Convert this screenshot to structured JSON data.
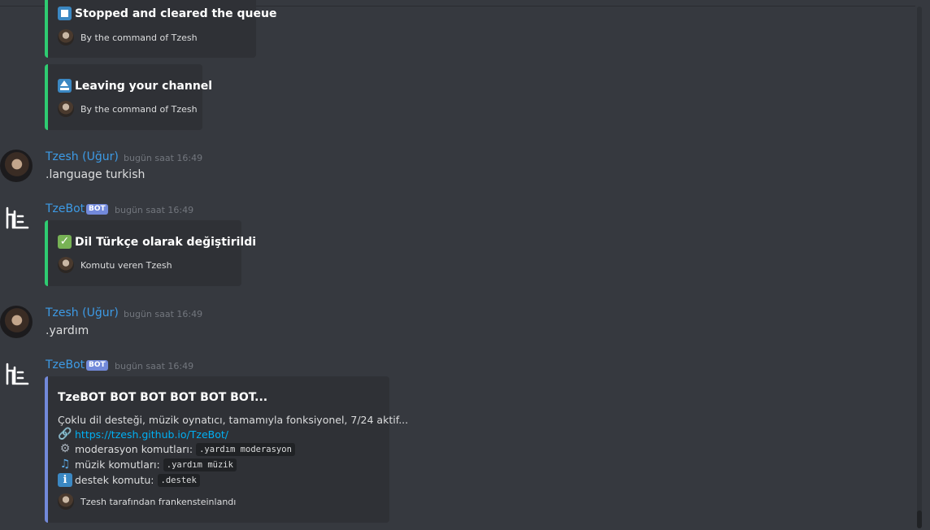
{
  "messages": [
    {
      "embeds": [
        {
          "title": "Stopped and cleared the queue",
          "icon": "stop-button-icon",
          "footer": "By the command of  Tzesh"
        },
        {
          "title": "Leaving your channel",
          "icon": "eject-button-icon",
          "footer": "By the command of Tzesh"
        }
      ]
    },
    {
      "username": "Tzesh (Uğur)",
      "timestamp": "bugün saat 16:49",
      "text": ".language turkish"
    },
    {
      "username": "TzeBot",
      "badge": "BOT",
      "timestamp": "bugün saat 16:49",
      "embed": {
        "title": "Dil Türkçe olarak değiştirildi",
        "icon": "check-mark-icon",
        "footer": "Komutu veren  Tzesh"
      }
    },
    {
      "username": "Tzesh (Uğur)",
      "timestamp": "bugün saat 16:49",
      "text": ".yardım"
    },
    {
      "username": "TzeBot",
      "badge": "BOT",
      "timestamp": "bugün saat 16:49",
      "embed": {
        "title": "TzeBOT BOT BOT BOT BOT BOT...",
        "description": "Çoklu dil desteği, müzik oynatıcı, tamamıyla fonksiyonel, 7/24 aktif...",
        "link": "https://tzesh.github.io/TzeBot/",
        "lines": [
          {
            "icon": "gear-icon",
            "label": "moderasyon komutları:",
            "code": ".yardım moderasyon"
          },
          {
            "icon": "music-notes-icon",
            "label": "müzik komutları:",
            "code": ".yardım müzik"
          },
          {
            "icon": "info-icon",
            "label": "destek komutu:",
            "code": ".destek"
          }
        ],
        "footer": "Tzesh tarafından frankensteinlandı"
      }
    }
  ],
  "colors": {
    "background": "#36393f",
    "embed_bg": "#2f3136",
    "success_border": "#2ecc71",
    "info_border": "#7289da",
    "username": "#3d9be6",
    "link": "#00b0f4"
  }
}
